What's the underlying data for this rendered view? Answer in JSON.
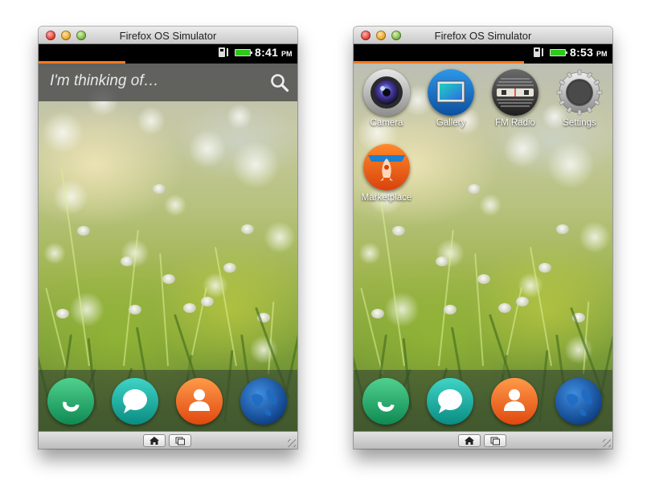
{
  "windows": [
    {
      "title": "Firefox OS Simulator",
      "status": {
        "time": "8:41",
        "ampm": "PM"
      },
      "search": {
        "placeholder": "I'm thinking of…"
      },
      "dock": [
        "phone-icon",
        "messages-icon",
        "contacts-icon",
        "browser-icon"
      ],
      "nav": {
        "home": "home-icon",
        "cards": "card-view-icon"
      }
    },
    {
      "title": "Firefox OS Simulator",
      "status": {
        "time": "8:53",
        "ampm": "PM"
      },
      "apps": [
        {
          "label": "Camera",
          "icon": "camera-icon"
        },
        {
          "label": "Gallery",
          "icon": "gallery-icon"
        },
        {
          "label": "FM Radio",
          "icon": "radio-icon"
        },
        {
          "label": "Settings",
          "icon": "gear-icon"
        },
        {
          "label": "Marketplace",
          "icon": "marketplace-icon"
        }
      ],
      "dock": [
        "phone-icon",
        "messages-icon",
        "contacts-icon",
        "browser-icon"
      ],
      "nav": {
        "home": "home-icon",
        "cards": "card-view-icon"
      }
    }
  ],
  "colors": {
    "accent_progress": "#f47a20",
    "battery": "#2ec81d",
    "phone": "#2bb673",
    "messages": "#1fb3a8",
    "contacts": "#f26a21",
    "browser": "#1b5aa6"
  }
}
